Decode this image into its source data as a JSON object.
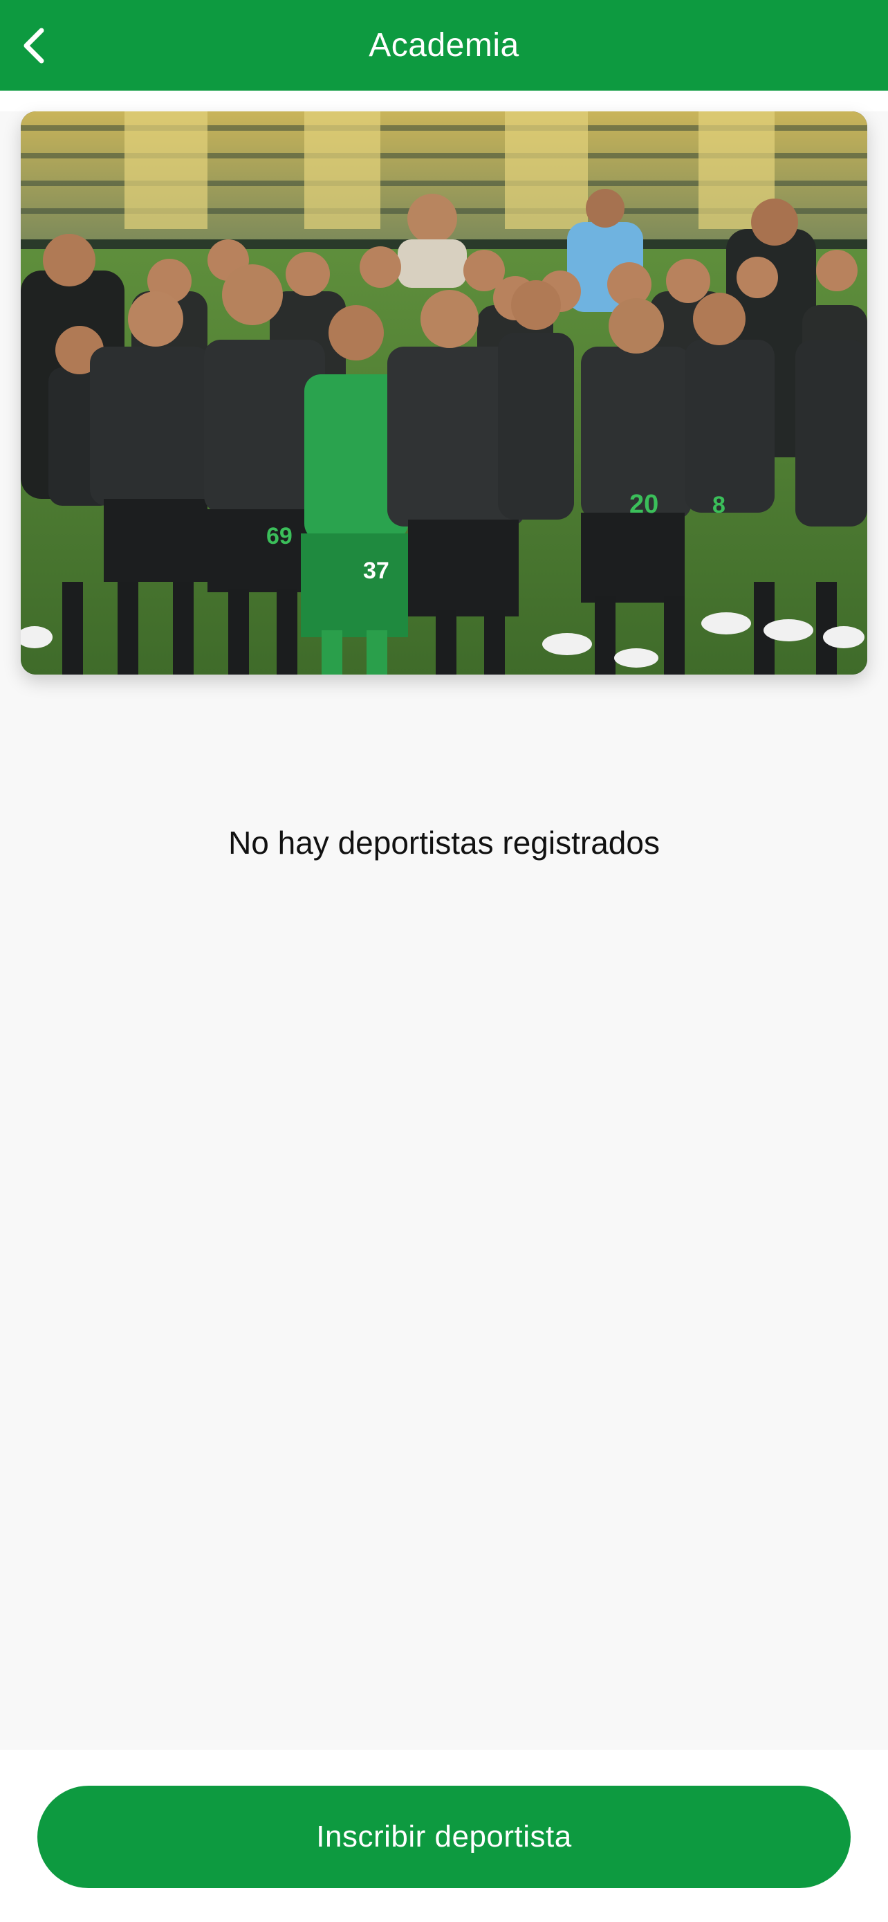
{
  "app_bar": {
    "title": "Academia",
    "back_icon": "chevron-left-icon",
    "background_color": "#0d9a40"
  },
  "banner": {
    "image_alt": "Foto grupal de deportistas de la academia en el estadio",
    "jersey_numbers": [
      "69",
      "37",
      "20",
      "8"
    ]
  },
  "main": {
    "empty_message": "No hay deportistas registrados"
  },
  "footer": {
    "enroll_button_label": "Inscribir deportista",
    "button_color": "#0d9a40"
  }
}
